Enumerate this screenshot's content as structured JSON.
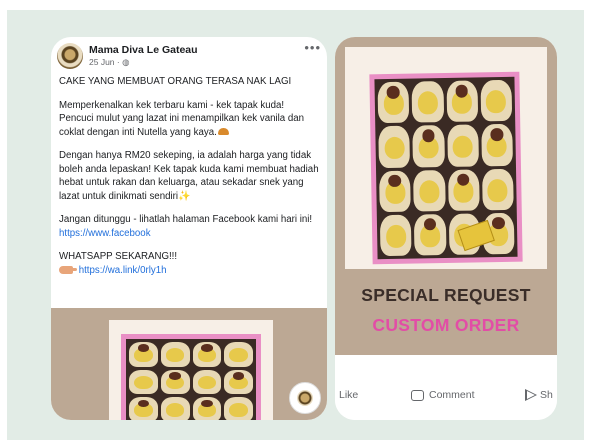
{
  "post": {
    "page_name": "Mama Diva Le Gateau",
    "meta": "25 Jun · ",
    "headline": "CAKE YANG MEMBUAT ORANG TERASA NAK LAGI",
    "para1": "Memperkenalkan kek terbaru kami - kek tapak kuda! Pencuci mulut yang lazat ini menampilkan kek vanila dan coklat dengan inti Nutella yang kaya.",
    "para2": "Dengan hanya RM20 sekeping, ia adalah harga yang tidak boleh anda lepaskan! Kek tapak kuda kami membuat hadiah hebat untuk rakan dan keluarga, atau sekadar snek yang lazat untuk dinikmati sendiri",
    "para3_text": "Jangan ditunggu - lihatlah halaman Facebook kami hari ini! ",
    "para3_link": "https://www.facebook",
    "cta": "WHATSAPP SEKARANG!!!",
    "whatsapp_link": "https://wa.link/0rly1h"
  },
  "promo": {
    "line1": "SPECIAL REQUEST",
    "line2": "CUSTOM ORDER"
  },
  "actions": {
    "like": "Like",
    "comment": "Comment",
    "share": "Sh"
  },
  "icons": [
    "globe-icon",
    "more-icon",
    "cake-emoji-icon",
    "sparkle-icon",
    "hand-pointing-icon",
    "comment-icon",
    "share-icon"
  ],
  "colors": {
    "background": "#e2ece6",
    "link": "#216fdb",
    "promo_dark": "#3a2d28",
    "promo_pink": "#e24da6",
    "photo_backdrop": "#bca894"
  }
}
